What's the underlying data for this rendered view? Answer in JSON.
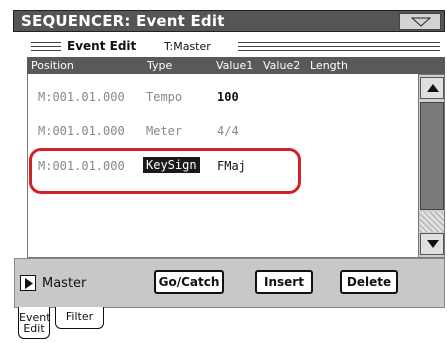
{
  "window": {
    "title": "SEQUENCER: Event Edit",
    "menu_icon": "triangle-down-icon"
  },
  "section": {
    "label": "Event Edit",
    "track": "T:Master"
  },
  "columns": [
    "Position",
    "Type",
    "Value1",
    "Value2",
    "Length"
  ],
  "events": [
    {
      "position": "M:001.01.000",
      "type": "Tempo",
      "value1": "100"
    },
    {
      "position": "M:001.01.000",
      "type": "Meter",
      "value1": "4/4"
    },
    {
      "position": "M:001.01.000",
      "type": "KeySign",
      "value1": "FMaj"
    }
  ],
  "bottom": {
    "track_label": "Master",
    "buttons": {
      "gocatch": "Go/Catch",
      "insert": "Insert",
      "delete": "Delete"
    }
  },
  "tabs": {
    "event_line1": "Event",
    "event_line2": "Edit",
    "filter": "Filter"
  },
  "colors": {
    "highlight": "#d4202a",
    "titlebar": "#555555"
  }
}
